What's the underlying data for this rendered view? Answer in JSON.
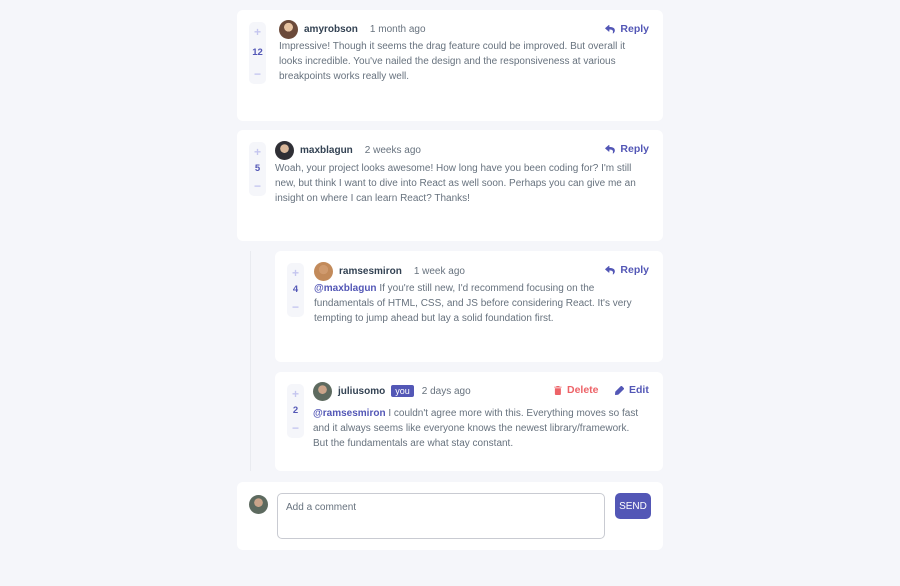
{
  "comments": [
    {
      "username": "amyrobson",
      "date": "1 month ago",
      "score": "12",
      "reply_label": "Reply",
      "text": "Impressive! Though it seems the drag feature could be improved. But overall it looks incredible. You've nailed the design and the responsiveness at various breakpoints works really well."
    },
    {
      "username": "maxblagun",
      "date": "2 weeks ago",
      "score": "5",
      "reply_label": "Reply",
      "text": "Woah, your project looks awesome! How long have you been coding for? I'm still new, but think I want to dive into React as well soon. Perhaps you can give me an insight on where I can learn React? Thanks!"
    }
  ],
  "replies": [
    {
      "username": "ramsesmiron",
      "date": "1 week ago",
      "score": "4",
      "reply_label": "Reply",
      "mention": "@maxblagun",
      "text": " If you're still new, I'd recommend focusing on the fundamentals of HTML, CSS, and JS before considering React. It's very tempting to jump ahead but lay a solid foundation first."
    },
    {
      "username": "juliusomo",
      "you_badge": "you",
      "date": "2 days ago",
      "score": "2",
      "delete_label": "Delete",
      "edit_label": "Edit",
      "mention": "@ramsesmiron",
      "text": " I couldn't agree more with this. Everything moves so fast and it always seems like everyone knows the newest library/framework. But the fundamentals are what stay constant."
    }
  ],
  "vote_controls": {
    "plus": "+",
    "minus": "−"
  },
  "new_comment": {
    "placeholder": "Add a comment",
    "send_label": "SEND"
  },
  "colors": {
    "accent": "#5357b6",
    "danger": "#ed6368",
    "background": "#f5f6fa"
  }
}
